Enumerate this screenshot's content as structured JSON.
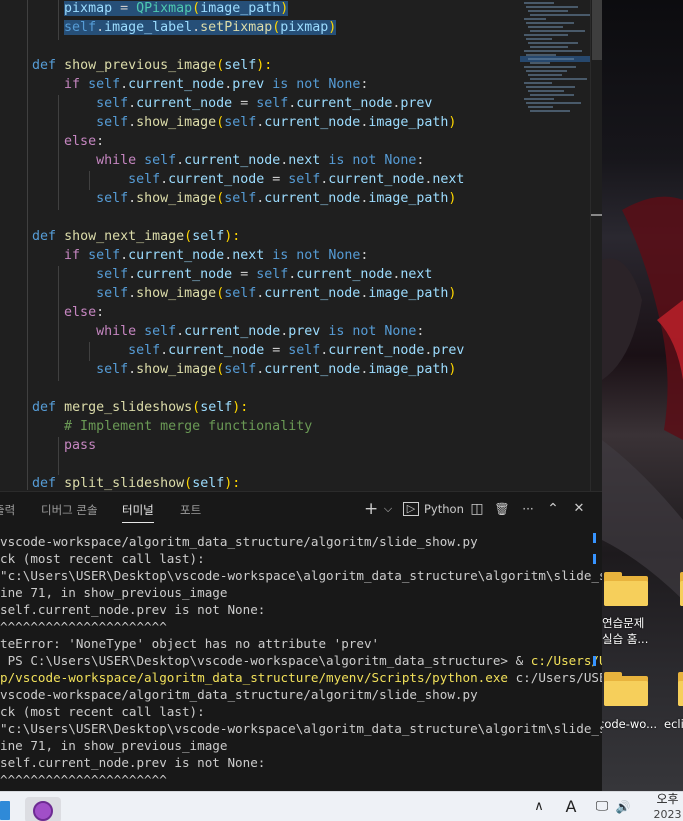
{
  "editor": {
    "lines": [
      [
        {
          "t": "        "
        },
        {
          "t": "pixmap",
          "c": "var hl"
        },
        {
          "t": " = ",
          "c": "hl"
        },
        {
          "t": "QPixmap",
          "c": "cls hl"
        },
        {
          "t": "(",
          "c": "p1 hl"
        },
        {
          "t": "image_path",
          "c": "var hl"
        },
        {
          "t": ")",
          "c": "p1 hl"
        }
      ],
      [
        {
          "t": "        "
        },
        {
          "t": "self",
          "c": "kw hl"
        },
        {
          "t": ".",
          "c": "hl"
        },
        {
          "t": "image_label",
          "c": "var hl"
        },
        {
          "t": ".",
          "c": "hl"
        },
        {
          "t": "setPixmap",
          "c": "fn hl"
        },
        {
          "t": "(",
          "c": "p1 hl"
        },
        {
          "t": "pixmap",
          "c": "var hl"
        },
        {
          "t": ")",
          "c": "p1 hl"
        }
      ],
      [
        {
          "t": ""
        }
      ],
      [
        {
          "t": "    "
        },
        {
          "t": "def",
          "c": "kw"
        },
        {
          "t": " "
        },
        {
          "t": "show_previous_image",
          "c": "fn"
        },
        {
          "t": "(",
          "c": "p1"
        },
        {
          "t": "self",
          "c": "prm"
        },
        {
          "t": "):",
          "c": "p1"
        }
      ],
      [
        {
          "t": "        "
        },
        {
          "t": "if",
          "c": "ctl"
        },
        {
          "t": " "
        },
        {
          "t": "self",
          "c": "kw"
        },
        {
          "t": "."
        },
        {
          "t": "current_node",
          "c": "var"
        },
        {
          "t": "."
        },
        {
          "t": "prev",
          "c": "var"
        },
        {
          "t": " "
        },
        {
          "t": "is not",
          "c": "kw"
        },
        {
          "t": " "
        },
        {
          "t": "None",
          "c": "kw"
        },
        {
          "t": ":"
        }
      ],
      [
        {
          "t": "            "
        },
        {
          "t": "self",
          "c": "kw"
        },
        {
          "t": "."
        },
        {
          "t": "current_node",
          "c": "var"
        },
        {
          "t": " = "
        },
        {
          "t": "self",
          "c": "kw"
        },
        {
          "t": "."
        },
        {
          "t": "current_node",
          "c": "var"
        },
        {
          "t": "."
        },
        {
          "t": "prev",
          "c": "var"
        }
      ],
      [
        {
          "t": "            "
        },
        {
          "t": "self",
          "c": "kw"
        },
        {
          "t": "."
        },
        {
          "t": "show_image",
          "c": "fn"
        },
        {
          "t": "(",
          "c": "p1"
        },
        {
          "t": "self",
          "c": "kw"
        },
        {
          "t": "."
        },
        {
          "t": "current_node",
          "c": "var"
        },
        {
          "t": "."
        },
        {
          "t": "image_path",
          "c": "var"
        },
        {
          "t": ")",
          "c": "p1"
        }
      ],
      [
        {
          "t": "        "
        },
        {
          "t": "else",
          "c": "ctl"
        },
        {
          "t": ":"
        }
      ],
      [
        {
          "t": "            "
        },
        {
          "t": "while",
          "c": "ctl"
        },
        {
          "t": " "
        },
        {
          "t": "self",
          "c": "kw"
        },
        {
          "t": "."
        },
        {
          "t": "current_node",
          "c": "var"
        },
        {
          "t": "."
        },
        {
          "t": "next",
          "c": "var"
        },
        {
          "t": " "
        },
        {
          "t": "is not",
          "c": "kw"
        },
        {
          "t": " "
        },
        {
          "t": "None",
          "c": "kw"
        },
        {
          "t": ":"
        }
      ],
      [
        {
          "t": "                "
        },
        {
          "t": "self",
          "c": "kw"
        },
        {
          "t": "."
        },
        {
          "t": "current_node",
          "c": "var"
        },
        {
          "t": " = "
        },
        {
          "t": "self",
          "c": "kw"
        },
        {
          "t": "."
        },
        {
          "t": "current_node",
          "c": "var"
        },
        {
          "t": "."
        },
        {
          "t": "next",
          "c": "var"
        }
      ],
      [
        {
          "t": "            "
        },
        {
          "t": "self",
          "c": "kw"
        },
        {
          "t": "."
        },
        {
          "t": "show_image",
          "c": "fn"
        },
        {
          "t": "(",
          "c": "p1"
        },
        {
          "t": "self",
          "c": "kw"
        },
        {
          "t": "."
        },
        {
          "t": "current_node",
          "c": "var"
        },
        {
          "t": "."
        },
        {
          "t": "image_path",
          "c": "var"
        },
        {
          "t": ")",
          "c": "p1"
        }
      ],
      [
        {
          "t": ""
        }
      ],
      [
        {
          "t": "    "
        },
        {
          "t": "def",
          "c": "kw"
        },
        {
          "t": " "
        },
        {
          "t": "show_next_image",
          "c": "fn"
        },
        {
          "t": "(",
          "c": "p1"
        },
        {
          "t": "self",
          "c": "prm"
        },
        {
          "t": "):",
          "c": "p1"
        }
      ],
      [
        {
          "t": "        "
        },
        {
          "t": "if",
          "c": "ctl"
        },
        {
          "t": " "
        },
        {
          "t": "self",
          "c": "kw"
        },
        {
          "t": "."
        },
        {
          "t": "current_node",
          "c": "var"
        },
        {
          "t": "."
        },
        {
          "t": "next",
          "c": "var"
        },
        {
          "t": " "
        },
        {
          "t": "is not",
          "c": "kw"
        },
        {
          "t": " "
        },
        {
          "t": "None",
          "c": "kw"
        },
        {
          "t": ":"
        }
      ],
      [
        {
          "t": "            "
        },
        {
          "t": "self",
          "c": "kw"
        },
        {
          "t": "."
        },
        {
          "t": "current_node",
          "c": "var"
        },
        {
          "t": " = "
        },
        {
          "t": "self",
          "c": "kw"
        },
        {
          "t": "."
        },
        {
          "t": "current_node",
          "c": "var"
        },
        {
          "t": "."
        },
        {
          "t": "next",
          "c": "var"
        }
      ],
      [
        {
          "t": "            "
        },
        {
          "t": "self",
          "c": "kw"
        },
        {
          "t": "."
        },
        {
          "t": "show_image",
          "c": "fn"
        },
        {
          "t": "(",
          "c": "p1"
        },
        {
          "t": "self",
          "c": "kw"
        },
        {
          "t": "."
        },
        {
          "t": "current_node",
          "c": "var"
        },
        {
          "t": "."
        },
        {
          "t": "image_path",
          "c": "var"
        },
        {
          "t": ")",
          "c": "p1"
        }
      ],
      [
        {
          "t": "        "
        },
        {
          "t": "else",
          "c": "ctl"
        },
        {
          "t": ":"
        }
      ],
      [
        {
          "t": "            "
        },
        {
          "t": "while",
          "c": "ctl"
        },
        {
          "t": " "
        },
        {
          "t": "self",
          "c": "kw"
        },
        {
          "t": "."
        },
        {
          "t": "current_node",
          "c": "var"
        },
        {
          "t": "."
        },
        {
          "t": "prev",
          "c": "var"
        },
        {
          "t": " "
        },
        {
          "t": "is not",
          "c": "kw"
        },
        {
          "t": " "
        },
        {
          "t": "None",
          "c": "kw"
        },
        {
          "t": ":"
        }
      ],
      [
        {
          "t": "                "
        },
        {
          "t": "self",
          "c": "kw"
        },
        {
          "t": "."
        },
        {
          "t": "current_node",
          "c": "var"
        },
        {
          "t": " = "
        },
        {
          "t": "self",
          "c": "kw"
        },
        {
          "t": "."
        },
        {
          "t": "current_node",
          "c": "var"
        },
        {
          "t": "."
        },
        {
          "t": "prev",
          "c": "var"
        }
      ],
      [
        {
          "t": "            "
        },
        {
          "t": "self",
          "c": "kw"
        },
        {
          "t": "."
        },
        {
          "t": "show_image",
          "c": "fn"
        },
        {
          "t": "(",
          "c": "p1"
        },
        {
          "t": "self",
          "c": "kw"
        },
        {
          "t": "."
        },
        {
          "t": "current_node",
          "c": "var"
        },
        {
          "t": "."
        },
        {
          "t": "image_path",
          "c": "var"
        },
        {
          "t": ")",
          "c": "p1"
        }
      ],
      [
        {
          "t": ""
        }
      ],
      [
        {
          "t": "    "
        },
        {
          "t": "def",
          "c": "kw"
        },
        {
          "t": " "
        },
        {
          "t": "merge_slideshows",
          "c": "fn"
        },
        {
          "t": "(",
          "c": "p1"
        },
        {
          "t": "self",
          "c": "prm"
        },
        {
          "t": "):",
          "c": "p1"
        }
      ],
      [
        {
          "t": "        "
        },
        {
          "t": "# Implement merge functionality",
          "c": "cm"
        }
      ],
      [
        {
          "t": "        "
        },
        {
          "t": "pass",
          "c": "ctl"
        }
      ],
      [
        {
          "t": ""
        }
      ],
      [
        {
          "t": "    "
        },
        {
          "t": "def",
          "c": "kw"
        },
        {
          "t": " "
        },
        {
          "t": "split_slideshow",
          "c": "fn"
        },
        {
          "t": "(",
          "c": "p1"
        },
        {
          "t": "self",
          "c": "prm"
        },
        {
          "t": "):",
          "c": "p1"
        }
      ]
    ]
  },
  "panel": {
    "tabs": [
      {
        "label": "출력",
        "active": false
      },
      {
        "label": "디버그 콘솔",
        "active": false
      },
      {
        "label": "터미널",
        "active": true
      },
      {
        "label": "포트",
        "active": false
      }
    ],
    "tools": {
      "add": "+",
      "add_dropdown": "⌵",
      "terminal_icon": "▷",
      "terminal_name": "Python",
      "split": "◫",
      "trash": "🗑",
      "more": "···",
      "maximize": "⌃",
      "close": "✕"
    },
    "terminal_lines": [
      [
        {
          "t": "vscode-workspace/algoritm_data_structure/algoritm/slide_show.py"
        }
      ],
      [
        {
          "t": "ck (most recent call last):"
        }
      ],
      [
        {
          "t": "\"c:\\Users\\USER\\Desktop\\vscode-workspace\\algoritm_data_structure\\algoritm\\slide_show"
        }
      ],
      [
        {
          "t": "ine 71, in show_previous_image"
        }
      ],
      [
        {
          "t": "self.current_node.prev is not None:"
        }
      ],
      [
        {
          "t": "^^^^^^^^^^^^^^^^^^^^^^"
        }
      ],
      [
        {
          "t": "teError: 'NoneType' object has no attribute 'prev'"
        }
      ],
      [
        {
          "t": " PS C:\\Users\\USER\\Desktop\\vscode-workspace\\algoritm_data_structure> & "
        },
        {
          "t": "c:/Users/USER",
          "c": "y"
        }
      ],
      [
        {
          "t": "p/vscode-workspace/algoritm_data_structure/myenv/Scripts/python.exe",
          "c": "y"
        },
        {
          "t": " c:/Users/USER/D"
        }
      ],
      [
        {
          "t": "vscode-workspace/algoritm_data_structure/algoritm/slide_show.py"
        }
      ],
      [
        {
          "t": "ck (most recent call last):"
        }
      ],
      [
        {
          "t": "\"c:\\Users\\USER\\Desktop\\vscode-workspace\\algoritm_data_structure\\algoritm\\slide_show"
        }
      ],
      [
        {
          "t": "ine 71, in show_previous_image"
        }
      ],
      [
        {
          "t": "self.current_node.prev is not None:"
        }
      ],
      [
        {
          "t": "^^^^^^^^^^^^^^^^^^^^^^"
        }
      ]
    ]
  },
  "desktop": {
    "icons": [
      {
        "label_line1": "연습문제",
        "label_line2": "실습 홈..."
      },
      {
        "label_line1": "code-wo..."
      },
      {
        "label_line1": "ecli"
      }
    ]
  },
  "taskbar": {
    "chevron": "∧",
    "ime": "A",
    "speaker": "🔊",
    "network": "🖵",
    "time": "오후",
    "date": "2023"
  },
  "colors": {
    "editor_bg": "#1f1f1f",
    "panel_bg": "#181818",
    "accent": "#3794ff",
    "path_highlight": "#f1e05a"
  }
}
